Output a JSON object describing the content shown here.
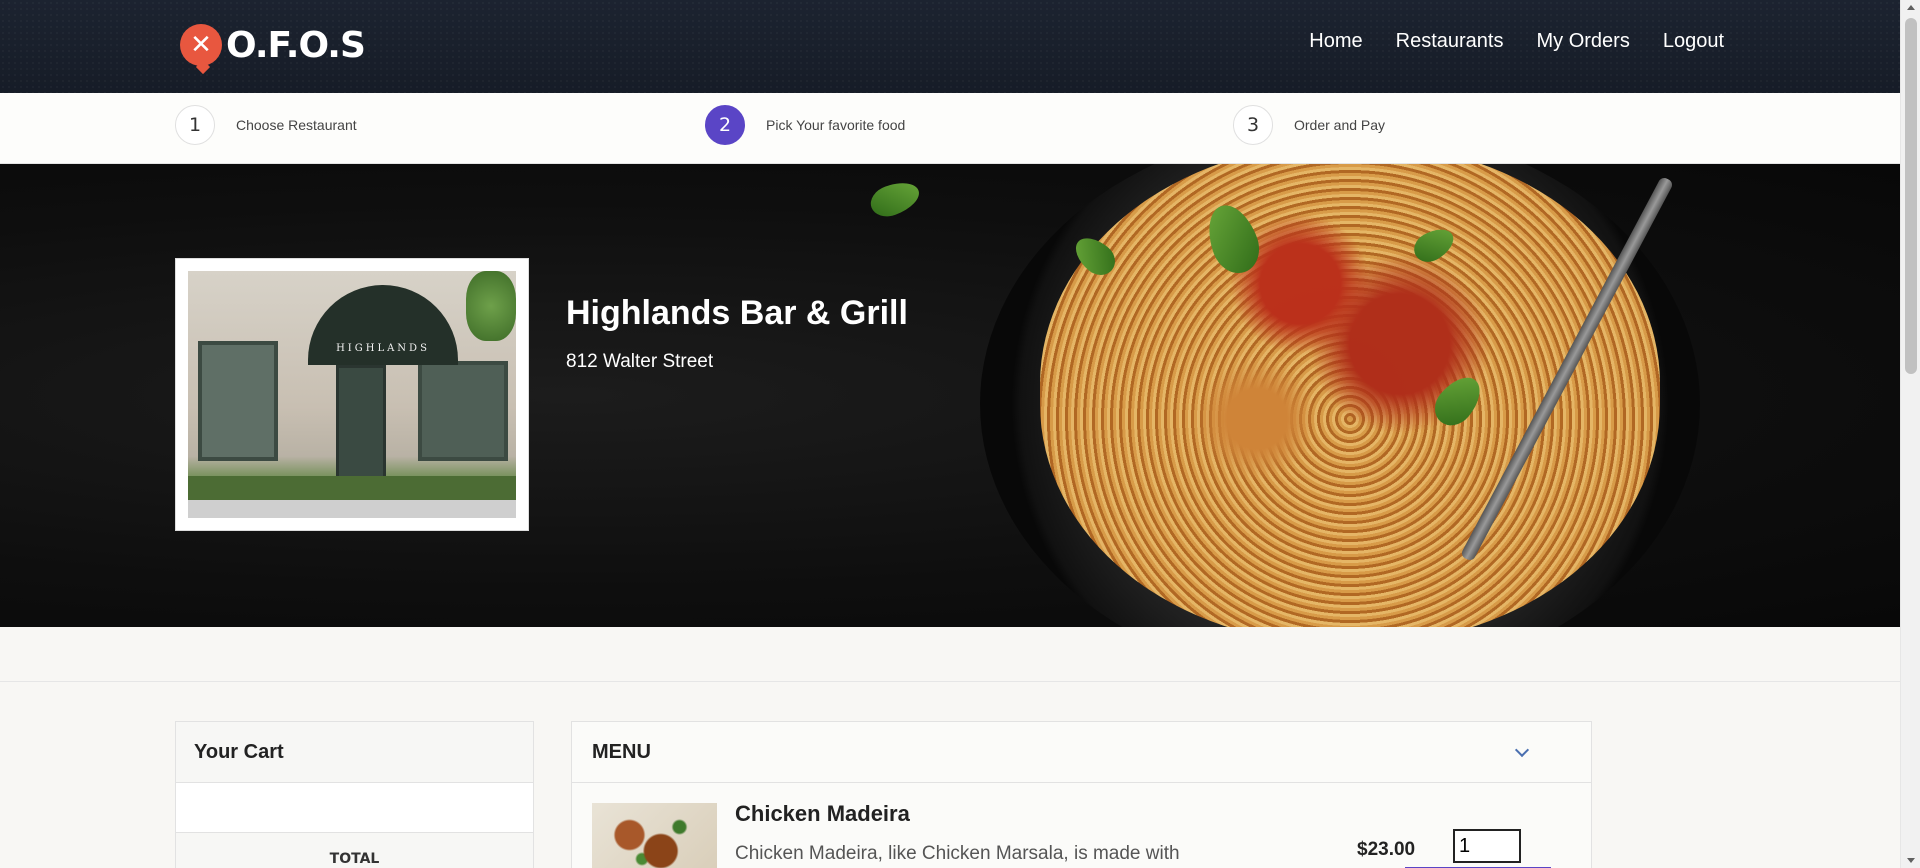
{
  "app": {
    "logo_icon": "fork-knife-icon",
    "logo_text": "O.F.O.S"
  },
  "nav": {
    "items": [
      {
        "label": "Home"
      },
      {
        "label": "Restaurants"
      },
      {
        "label": "My Orders"
      },
      {
        "label": "Logout"
      }
    ]
  },
  "steps": [
    {
      "num": "1",
      "label": "Choose Restaurant",
      "active": false
    },
    {
      "num": "2",
      "label": "Pick Your favorite food",
      "active": true
    },
    {
      "num": "3",
      "label": "Order and Pay",
      "active": false
    }
  ],
  "restaurant": {
    "name": "Highlands Bar & Grill",
    "address": "812 Walter Street",
    "photo_sign": "HIGHLANDS"
  },
  "cart": {
    "title": "Your Cart",
    "footer_label": "TOTAL"
  },
  "menu": {
    "title": "MENU",
    "items": [
      {
        "name": "Chicken Madeira",
        "description": "Chicken Madeira, like Chicken Marsala, is made with",
        "price": "$23.00",
        "quantity": "1"
      }
    ]
  },
  "colors": {
    "accent": "#5a45c6",
    "logo": "#e8573f",
    "navbar": "#1c2330"
  }
}
